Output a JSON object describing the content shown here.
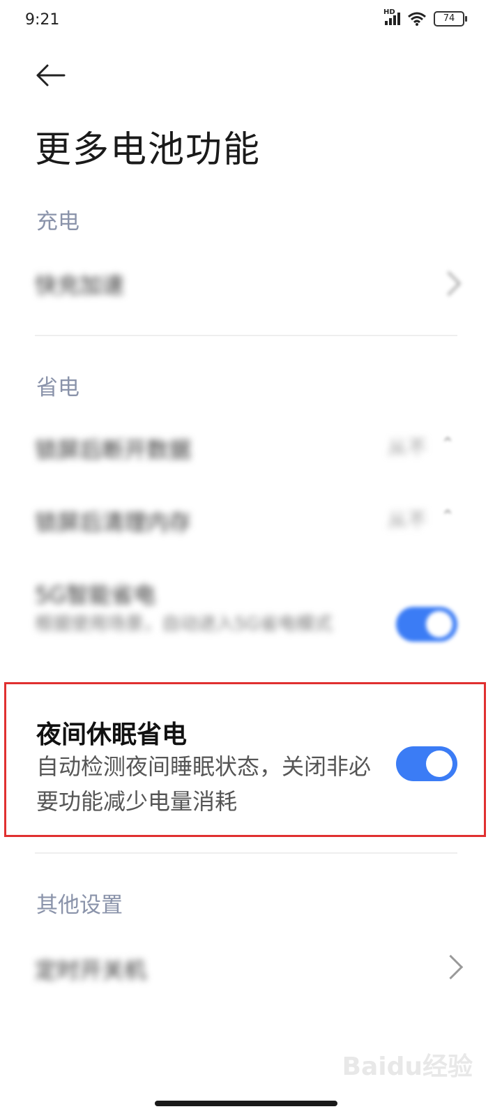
{
  "status_bar": {
    "time": "9:21",
    "network_label": "HD",
    "battery": "74"
  },
  "header": {
    "title": "更多电池功能"
  },
  "sections": {
    "charging": {
      "label": "充电",
      "items": [
        {
          "title": "快充加速"
        }
      ]
    },
    "power_saving": {
      "label": "省电",
      "items": [
        {
          "title": "锁屏后断开数据",
          "value": "从不"
        },
        {
          "title": "锁屏后清理内存",
          "value": "从不"
        },
        {
          "title": "5G智能省电",
          "subtitle": "根据使用场景，自动进入5G省电模式",
          "toggle_on": true
        }
      ]
    },
    "night_sleep": {
      "title": "夜间休眠省电",
      "subtitle": "自动检测夜间睡眠状态，关闭非必要功能减少电量消耗",
      "toggle_on": true
    },
    "other": {
      "label": "其他设置",
      "items": [
        {
          "title": "定时开关机"
        }
      ]
    }
  },
  "watermark": "Baidu经验",
  "colors": {
    "accent": "#3b7cf5",
    "section_label": "#8a93aa",
    "highlight_border": "#e03030"
  }
}
